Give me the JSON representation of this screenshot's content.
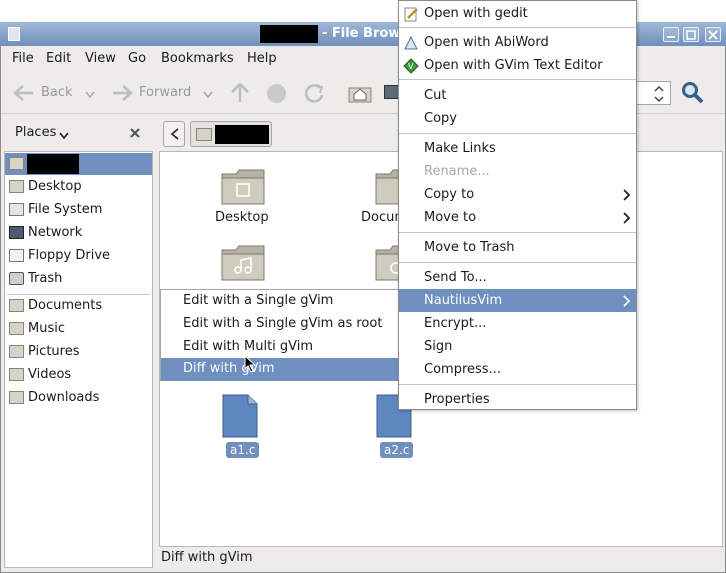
{
  "window": {
    "title": "- File Brow"
  },
  "menubar": [
    "File",
    "Edit",
    "View",
    "Go",
    "Bookmarks",
    "Help"
  ],
  "toolbar": {
    "back": "Back",
    "forward": "Forward"
  },
  "sidebar": {
    "header": "Places",
    "items": [
      "Desktop",
      "File System",
      "Network",
      "Floppy Drive",
      "Trash"
    ],
    "bookmarks": [
      "Documents",
      "Music",
      "Pictures",
      "Videos",
      "Downloads"
    ]
  },
  "files": {
    "desktop": "Desktop",
    "documents": "Docum",
    "a1": "a1.c",
    "a2": "a2.c"
  },
  "statusbar": "Diff with gVim",
  "submenu": [
    "Edit with a Single gVim",
    "Edit with a Single gVim as root",
    "Edit with Multi gVim",
    "Diff with gVim"
  ],
  "context_menu": {
    "open_gedit": "Open with gedit",
    "open_abiword": "Open with AbiWord",
    "open_gvim": "Open with GVim Text Editor",
    "cut": "Cut",
    "copy": "Copy",
    "make_links": "Make Links",
    "rename": "Rename...",
    "copy_to": "Copy to",
    "move_to": "Move to",
    "move_to_trash": "Move to Trash",
    "send_to": "Send To...",
    "nautilusvim": "NautilusVim",
    "encrypt": "Encrypt...",
    "sign": "Sign",
    "compress": "Compress...",
    "properties": "Properties"
  },
  "colors": {
    "selection": "#6e8fbf",
    "title_top": "#9fb8d8",
    "title_bottom": "#6f8fba"
  }
}
